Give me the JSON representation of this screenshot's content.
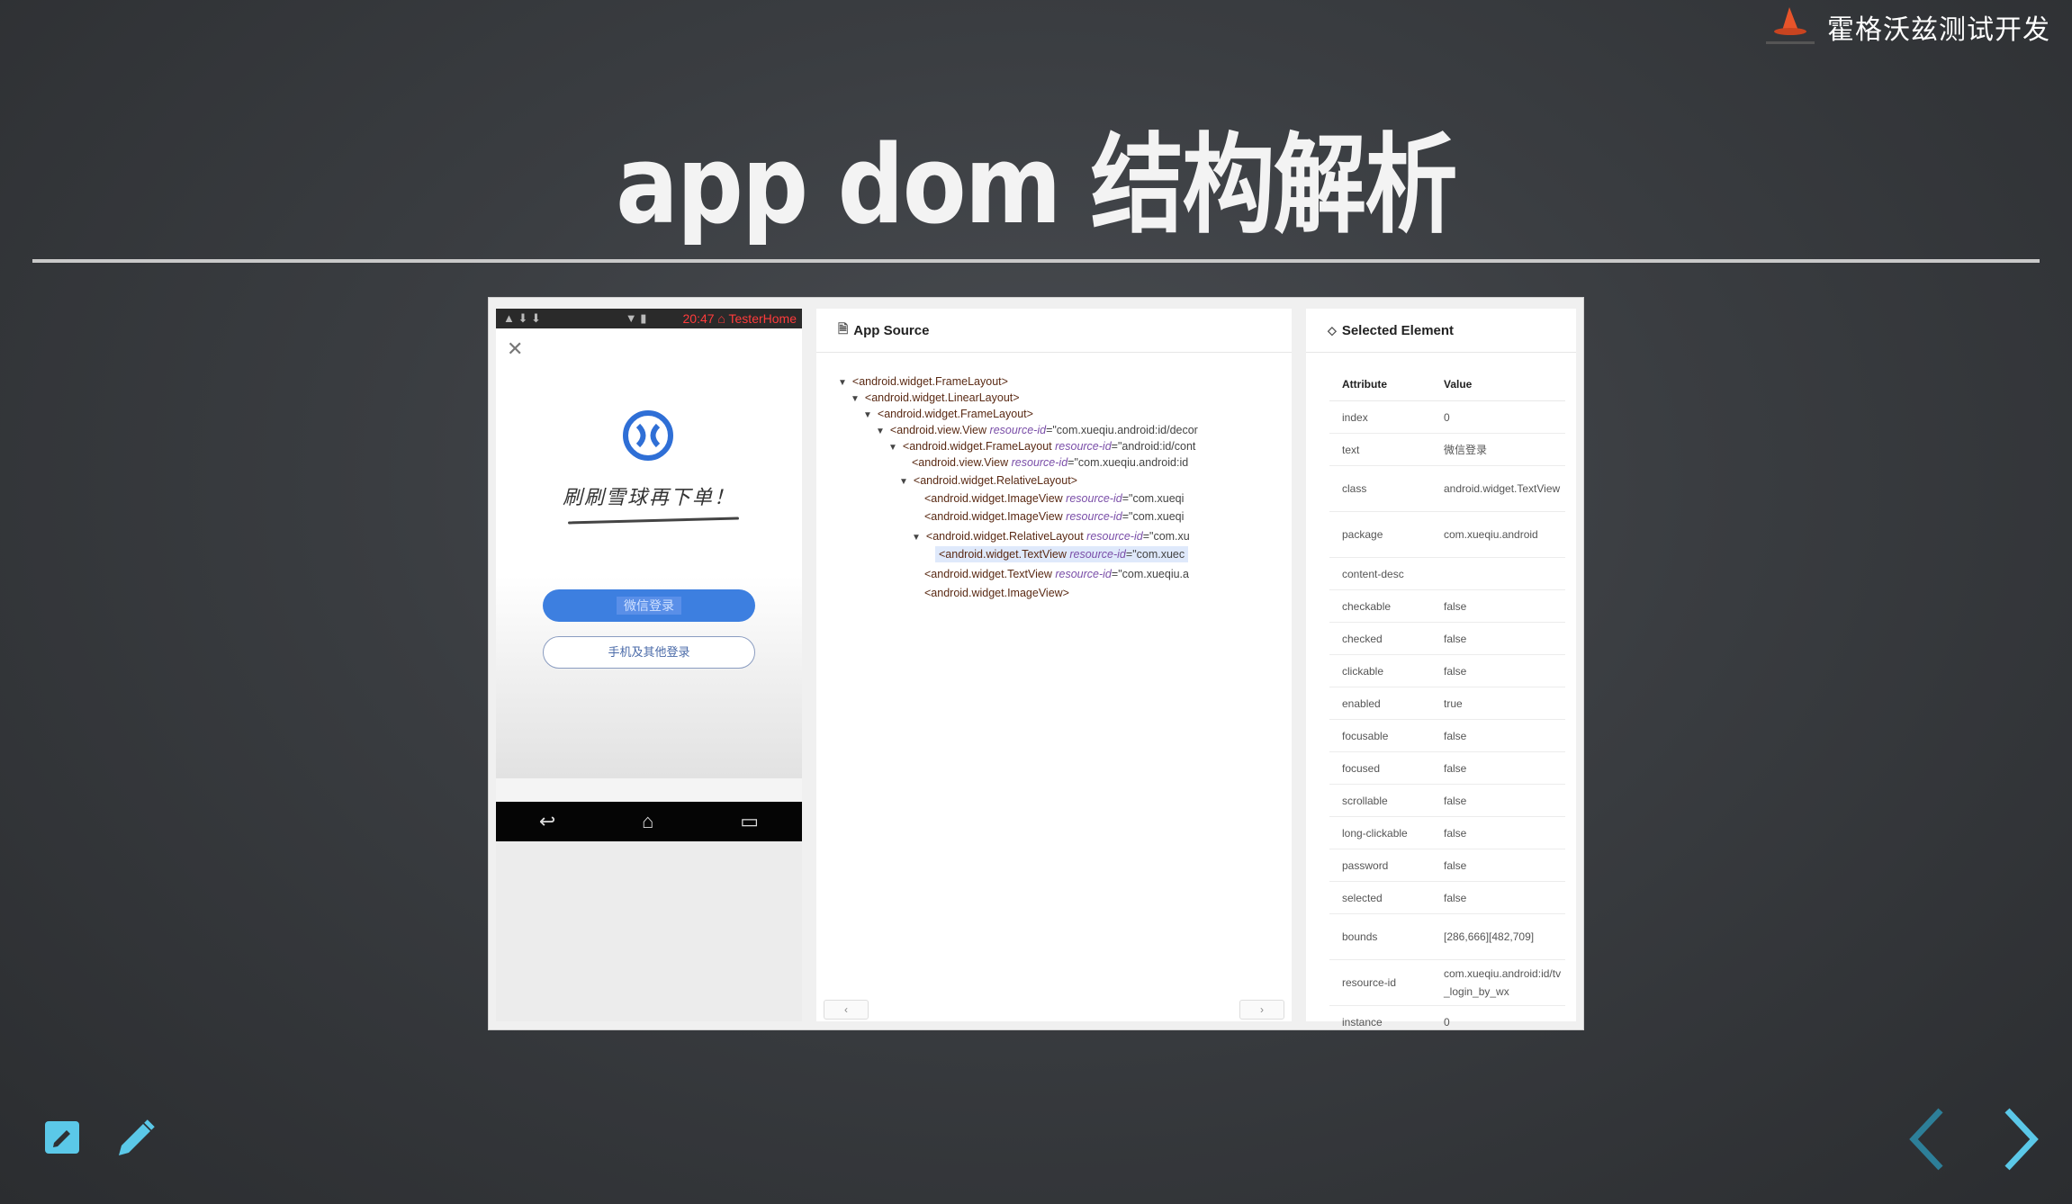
{
  "brand": {
    "name": "霍格沃兹测试开发"
  },
  "slide": {
    "title": "app dom 结构解析"
  },
  "phone": {
    "status_time": "20:47 ⌂ TesterHome",
    "slogan": "刷刷雪球再下单！",
    "wechat_login": "微信登录",
    "other_login": "手机及其他登录"
  },
  "source_panel": {
    "title": "App Source",
    "nodes": [
      {
        "tag": "<android.widget.FrameLayout>",
        "attr": "",
        "val": ""
      },
      {
        "tag": "<android.widget.LinearLayout>",
        "attr": "",
        "val": ""
      },
      {
        "tag": "<android.widget.FrameLayout>",
        "attr": "",
        "val": ""
      },
      {
        "tag": "<android.view.View",
        "attr": "resource-id",
        "val": "=\"com.xueqiu.android:id/decor"
      },
      {
        "tag": "<android.widget.FrameLayout",
        "attr": "resource-id",
        "val": "=\"android:id/cont"
      },
      {
        "tag": "<android.view.View",
        "attr": "resource-id",
        "val": "=\"com.xueqiu.android:id"
      },
      {
        "tag": "<android.widget.RelativeLayout>",
        "attr": "",
        "val": ""
      },
      {
        "tag": "<android.widget.ImageView",
        "attr": "resource-id",
        "val": "=\"com.xueqi"
      },
      {
        "tag": "<android.widget.ImageView",
        "attr": "resource-id",
        "val": "=\"com.xueqi"
      },
      {
        "tag": "<android.widget.RelativeLayout",
        "attr": "resource-id",
        "val": "=\"com.xu"
      },
      {
        "tag": "<android.widget.TextView",
        "attr": "resource-id",
        "val": "=\"com.xuec"
      },
      {
        "tag": "<android.widget.TextView",
        "attr": "resource-id",
        "val": "=\"com.xueqiu.a"
      },
      {
        "tag": "<android.widget.ImageView>",
        "attr": "",
        "val": ""
      }
    ]
  },
  "selected_panel": {
    "title": "Selected Element",
    "col_attribute": "Attribute",
    "col_value": "Value",
    "rows": [
      {
        "k": "index",
        "v": "0"
      },
      {
        "k": "text",
        "v": "微信登录"
      },
      {
        "k": "class",
        "v": "android.widget.TextView"
      },
      {
        "k": "package",
        "v": "com.xueqiu.android"
      },
      {
        "k": "content-desc",
        "v": ""
      },
      {
        "k": "checkable",
        "v": "false"
      },
      {
        "k": "checked",
        "v": "false"
      },
      {
        "k": "clickable",
        "v": "false"
      },
      {
        "k": "enabled",
        "v": "true"
      },
      {
        "k": "focusable",
        "v": "false"
      },
      {
        "k": "focused",
        "v": "false"
      },
      {
        "k": "scrollable",
        "v": "false"
      },
      {
        "k": "long-clickable",
        "v": "false"
      },
      {
        "k": "password",
        "v": "false"
      },
      {
        "k": "selected",
        "v": "false"
      },
      {
        "k": "bounds",
        "v": "[286,666][482,709]"
      },
      {
        "k": "resource-id",
        "v": "com.xueqiu.android:id/tv_login_by_wx"
      },
      {
        "k": "instance",
        "v": "0"
      }
    ]
  },
  "colors": {
    "accent": "#5bc8e8",
    "tree_tag": "#5a2a14",
    "tree_attr": "#7a4ea8"
  }
}
